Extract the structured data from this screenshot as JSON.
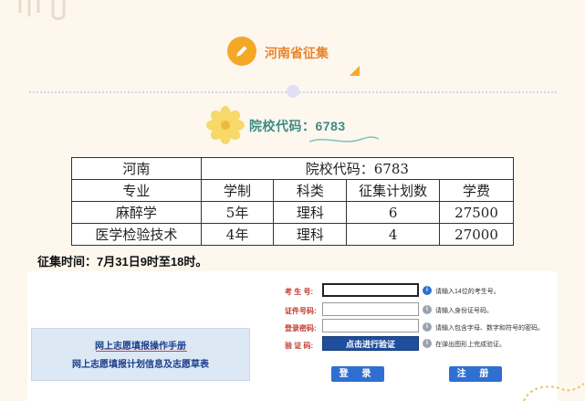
{
  "header": {
    "title": "河南省征集",
    "school_code_title": "院校代码：6783"
  },
  "plan_table": {
    "province": "河南",
    "school_code": "院校代码：6783",
    "columns": [
      "专业",
      "学制",
      "科类",
      "征集计划数",
      "学费"
    ],
    "rows": [
      [
        "麻醉学",
        "5年",
        "理科",
        "6",
        "27500"
      ],
      [
        "医学检验技术",
        "4年",
        "理科",
        "4",
        "27000"
      ]
    ]
  },
  "time_notice": "征集时间：7月31日9时至18时。",
  "login": {
    "manual_link": "网上志愿填报操作手册",
    "plan_link": "网上志愿填报计划信息及志愿草表",
    "fields": [
      {
        "label": "考 生 号:",
        "hint": "请输入14位的考生号。"
      },
      {
        "label": "证件号码:",
        "hint": "请输入身份证号码。"
      },
      {
        "label": "登录密码:",
        "hint": "请输入包含字母、数字和符号的密码。"
      },
      {
        "label": "验 证 码:",
        "hint": "在弹出图形上完成验证。"
      }
    ],
    "verify_button": "点击进行验证",
    "login_button": "登 录",
    "register_button": "注 册"
  },
  "colors": {
    "background": "#fdf7ee",
    "accent_orange": "#f4a825",
    "title_orange": "#e9852a",
    "code_teal": "#3a8c84",
    "button_blue": "#2f6fd1",
    "label_red": "#c0392b"
  }
}
